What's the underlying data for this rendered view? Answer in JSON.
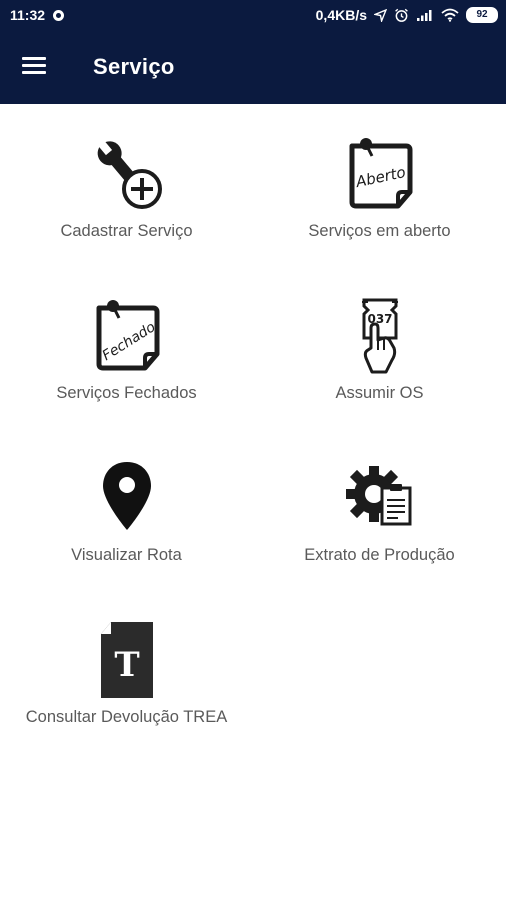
{
  "status_bar": {
    "time": "11:32",
    "network_speed": "0,4KB/s",
    "battery": "92"
  },
  "app_bar": {
    "title": "Serviço"
  },
  "menu": [
    {
      "id": "cadastrar",
      "label": "Cadastrar Serviço",
      "icon": "wrench-plus-icon"
    },
    {
      "id": "abertos",
      "label": "Serviços em aberto",
      "icon": "note-aberto-icon",
      "icon_text": "Aberto"
    },
    {
      "id": "fechados",
      "label": "Serviços Fechados",
      "icon": "note-fechado-icon",
      "icon_text": "Fechado"
    },
    {
      "id": "assumir",
      "label": "Assumir OS",
      "icon": "ticket-hand-icon",
      "icon_text": "037"
    },
    {
      "id": "rota",
      "label": "Visualizar Rota",
      "icon": "map-pin-icon"
    },
    {
      "id": "extrato",
      "label": "Extrato de Produção",
      "icon": "gear-document-icon"
    },
    {
      "id": "devolucao",
      "label": "Consultar Devolução TREA",
      "icon": "document-t-icon",
      "icon_text": "T"
    }
  ],
  "colors": {
    "bar_background": "#0b1a3f",
    "icon": "#1c1c1c",
    "label": "#5a5a5a"
  }
}
